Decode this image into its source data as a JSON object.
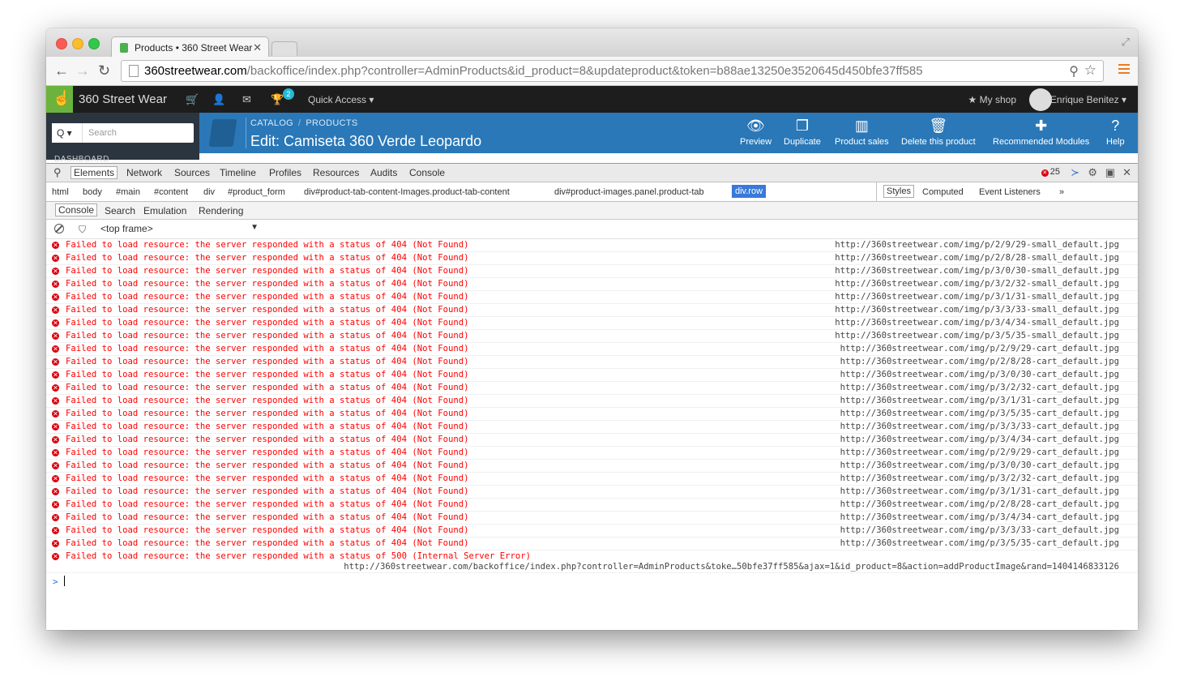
{
  "browser": {
    "tab_title": "Products • 360 Street Wear",
    "url_domain": "360streetwear.com",
    "url_path": "/backoffice/index.php?controller=AdminProducts&id_product=8&updateproduct&token=b88ae13250e3520645d450bfe37ff585"
  },
  "admin": {
    "shop_name": "360 Street Wear",
    "badge_count": "2",
    "quick_access": "Quick Access ▾",
    "my_shop": "★ My shop",
    "user_name": "Enrique Benitez ▾",
    "search_placeholder": "Search",
    "search_btn": "Q ▾",
    "sidebar_label": "DASHBOARD",
    "breadcrumb_1": "CATALOG",
    "breadcrumb_2": "PRODUCTS",
    "crumb_separator": "/",
    "page_title": "Edit: Camiseta 360 Verde Leopardo",
    "toolbar": [
      {
        "label": "Preview",
        "icon": "eye-icon"
      },
      {
        "label": "Duplicate",
        "icon": "copy-icon"
      },
      {
        "label": "Product sales",
        "icon": "bar-chart-icon"
      },
      {
        "label": "Delete this product",
        "icon": "trash-icon"
      },
      {
        "label": "Recommended Modules",
        "icon": "puzzle-icon"
      },
      {
        "label": "Help",
        "icon": "help-icon"
      }
    ]
  },
  "devtools": {
    "tabs": [
      "Elements",
      "Network",
      "Sources",
      "Timeline",
      "Profiles",
      "Resources",
      "Audits",
      "Console"
    ],
    "error_count": "25",
    "error_glyph": "✕",
    "breadcrumbs": [
      "html",
      "body",
      "#main",
      "#content",
      "div",
      "#product_form",
      "div#product-tab-content-Images.product-tab-content",
      "div#product-images.panel.product-tab",
      "div.row"
    ],
    "side_tabs": [
      "Styles",
      "Computed",
      "Event Listeners",
      "»"
    ],
    "drawer_tabs": [
      "Console",
      "Search",
      "Emulation",
      "Rendering"
    ],
    "frame": "<top frame>",
    "frame_arrow": "▼",
    "msg_404": "Failed to load resource: the server responded with a status of 404 (Not Found)",
    "msg_500": "Failed to load resource: the server responded with a status of 500 (Internal Server Error)",
    "url_prefix": "http://360streetwear.com/img/p/",
    "log_urls": [
      "2/9/29-small_default.jpg",
      "2/8/28-small_default.jpg",
      "3/0/30-small_default.jpg",
      "3/2/32-small_default.jpg",
      "3/1/31-small_default.jpg",
      "3/3/33-small_default.jpg",
      "3/4/34-small_default.jpg",
      "3/5/35-small_default.jpg",
      "2/9/29-cart_default.jpg",
      "2/8/28-cart_default.jpg",
      "3/0/30-cart_default.jpg",
      "3/2/32-cart_default.jpg",
      "3/1/31-cart_default.jpg",
      "3/5/35-cart_default.jpg",
      "3/3/33-cart_default.jpg",
      "3/4/34-cart_default.jpg",
      "2/9/29-cart_default.jpg",
      "3/0/30-cart_default.jpg",
      "3/2/32-cart_default.jpg",
      "3/1/31-cart_default.jpg",
      "2/8/28-cart_default.jpg",
      "3/4/34-cart_default.jpg",
      "3/3/33-cart_default.jpg",
      "3/5/35-cart_default.jpg"
    ],
    "last_url": "http://360streetwear.com/backoffice/index.php?controller=AdminProducts&toke…50bfe37ff585&ajax=1&id_product=8&action=addProductImage&rand=1404146833126",
    "prompt": ">"
  }
}
